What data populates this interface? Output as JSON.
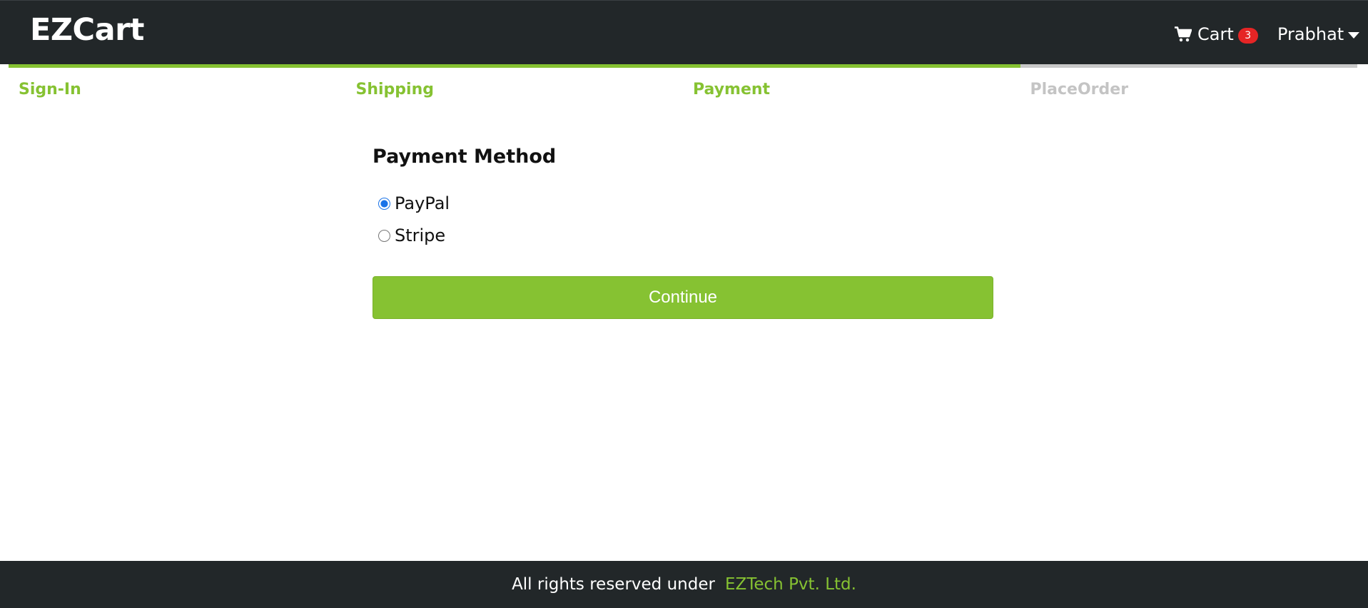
{
  "header": {
    "brand": "EZCart",
    "cart_label": "Cart",
    "cart_count": "3",
    "cart_icon": "shopping-cart-icon",
    "user_name": "Prabhat",
    "user_caret_icon": "caret-down-icon"
  },
  "steps": [
    {
      "label": "Sign-In",
      "active": true
    },
    {
      "label": "Shipping",
      "active": true
    },
    {
      "label": "Payment",
      "active": true
    },
    {
      "label": "PlaceOrder",
      "active": false
    }
  ],
  "payment": {
    "title": "Payment Method",
    "options": [
      {
        "label": "PayPal",
        "selected": true
      },
      {
        "label": "Stripe",
        "selected": false
      }
    ],
    "continue_label": "Continue"
  },
  "footer": {
    "text": "All rights reserved under",
    "link_label": "EZTech Pvt. Ltd."
  },
  "colors": {
    "header_bg": "#222729",
    "accent": "#86c232",
    "inactive_step": "#c4c4c4",
    "badge": "#e52525"
  }
}
